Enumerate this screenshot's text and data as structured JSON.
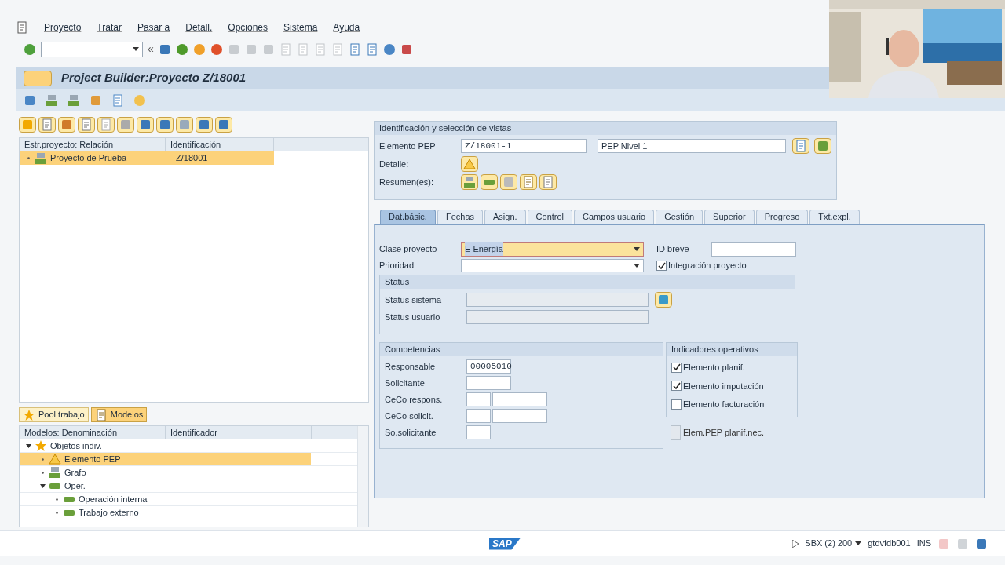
{
  "menu": [
    {
      "label": "Proyecto"
    },
    {
      "label": "Tratar"
    },
    {
      "label": "Pasar a"
    },
    {
      "label": "Detall."
    },
    {
      "label": "Opciones"
    },
    {
      "label": "Sistema"
    },
    {
      "label": "Ayuda"
    }
  ],
  "toolbar": {
    "collapse_glyph": "«"
  },
  "title": "Project Builder:Proyecto Z/18001",
  "structure_tree": {
    "columns": [
      "Estr.proyecto: Relación",
      "Identificación"
    ],
    "rows": [
      {
        "label": "Proyecto de Prueba",
        "id": "Z/18001",
        "selected": true
      }
    ]
  },
  "pool_tabs": [
    {
      "label": "Pool trabajo",
      "kind": "star",
      "selected": false
    },
    {
      "label": "Modelos",
      "kind": "pages",
      "selected": true
    }
  ],
  "models_tree": {
    "columns": [
      "Modelos: Denominación",
      "Identificador"
    ],
    "items": [
      {
        "label": "Objetos indiv.",
        "kind": "star",
        "selected": false,
        "expanded": true,
        "children": [
          {
            "label": "Elemento PEP",
            "kind": "warning",
            "selected": true
          },
          {
            "label": "Grafo",
            "kind": "network",
            "selected": false
          },
          {
            "label": "Oper.",
            "kind": "bar",
            "selected": false,
            "expanded": true,
            "children": [
              {
                "label": "Operación interna",
                "kind": "bar",
                "selected": false
              },
              {
                "label": "Trabajo externo",
                "kind": "bar",
                "selected": false
              }
            ]
          }
        ]
      }
    ]
  },
  "identification": {
    "title": "Identificación y selección de vistas",
    "element_label": "Elemento PEP",
    "element_value": "Z/18001-1",
    "description": "PEP Nivel 1",
    "detail_label": "Detalle:",
    "overview_label": "Resumen(es):"
  },
  "tabs": [
    {
      "label": "Dat.básic.",
      "selected": true
    },
    {
      "label": "Fechas",
      "selected": false
    },
    {
      "label": "Asign.",
      "selected": false
    },
    {
      "label": "Control",
      "selected": false
    },
    {
      "label": "Campos usuario",
      "selected": false
    },
    {
      "label": "Gestión",
      "selected": false
    },
    {
      "label": "Superior",
      "selected": false
    },
    {
      "label": "Progreso",
      "selected": false
    },
    {
      "label": "Txt.expl.",
      "selected": false
    }
  ],
  "basic_data": {
    "class_label": "Clase proyecto",
    "class_value": "E Energía",
    "class_focused": true,
    "short_id_label": "ID breve",
    "priority_label": "Prioridad",
    "integration": {
      "label": "Integración proyecto",
      "checked": true
    },
    "status": {
      "title": "Status",
      "rows": [
        "Status sistema",
        "Status usuario"
      ]
    },
    "competencias": {
      "title": "Competencias",
      "rows": [
        {
          "label": "Responsable",
          "value": "00005010",
          "kind": "single"
        },
        {
          "label": "Solicitante",
          "kind": "single"
        },
        {
          "label": "CeCo respons.",
          "kind": "double"
        },
        {
          "label": "CeCo solicit.",
          "kind": "double"
        },
        {
          "label": "So.solicitante",
          "kind": "short"
        }
      ]
    },
    "indicators": {
      "title": "Indicadores operativos",
      "items": [
        {
          "label": "Elemento planif.",
          "checked": true
        },
        {
          "label": "Elemento imputación",
          "checked": true
        },
        {
          "label": "Elemento facturación",
          "checked": false
        }
      ]
    },
    "planning_required": {
      "label": "Elem.PEP planif.nec.",
      "checked": false,
      "disabled": true
    }
  },
  "status_bar": {
    "logo": "SAP",
    "system": "SBX (2) 200",
    "server": "gtdvfdb001",
    "mode": "INS"
  }
}
